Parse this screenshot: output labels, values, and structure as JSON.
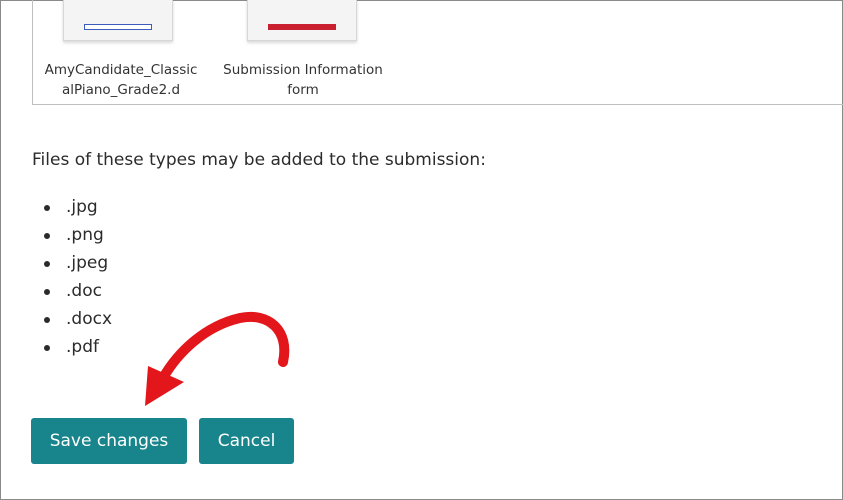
{
  "files": [
    {
      "name": "AmyCandidate_ClassicalPiano_Grade2.d",
      "icon": "document-thumbnail-icon",
      "accent": "#3b5bbd"
    },
    {
      "name": "Submission Information form",
      "icon": "document-thumbnail-icon",
      "accent": "#c8202e"
    }
  ],
  "types_heading": "Files of these types may be added to the submission:",
  "types": [
    ".jpg",
    ".png",
    ".jpeg",
    ".doc",
    ".docx",
    ".pdf"
  ],
  "buttons": {
    "save_label": "Save changes",
    "cancel_label": "Cancel"
  },
  "colors": {
    "button": "#17858b",
    "arrow": "#e3161b"
  }
}
